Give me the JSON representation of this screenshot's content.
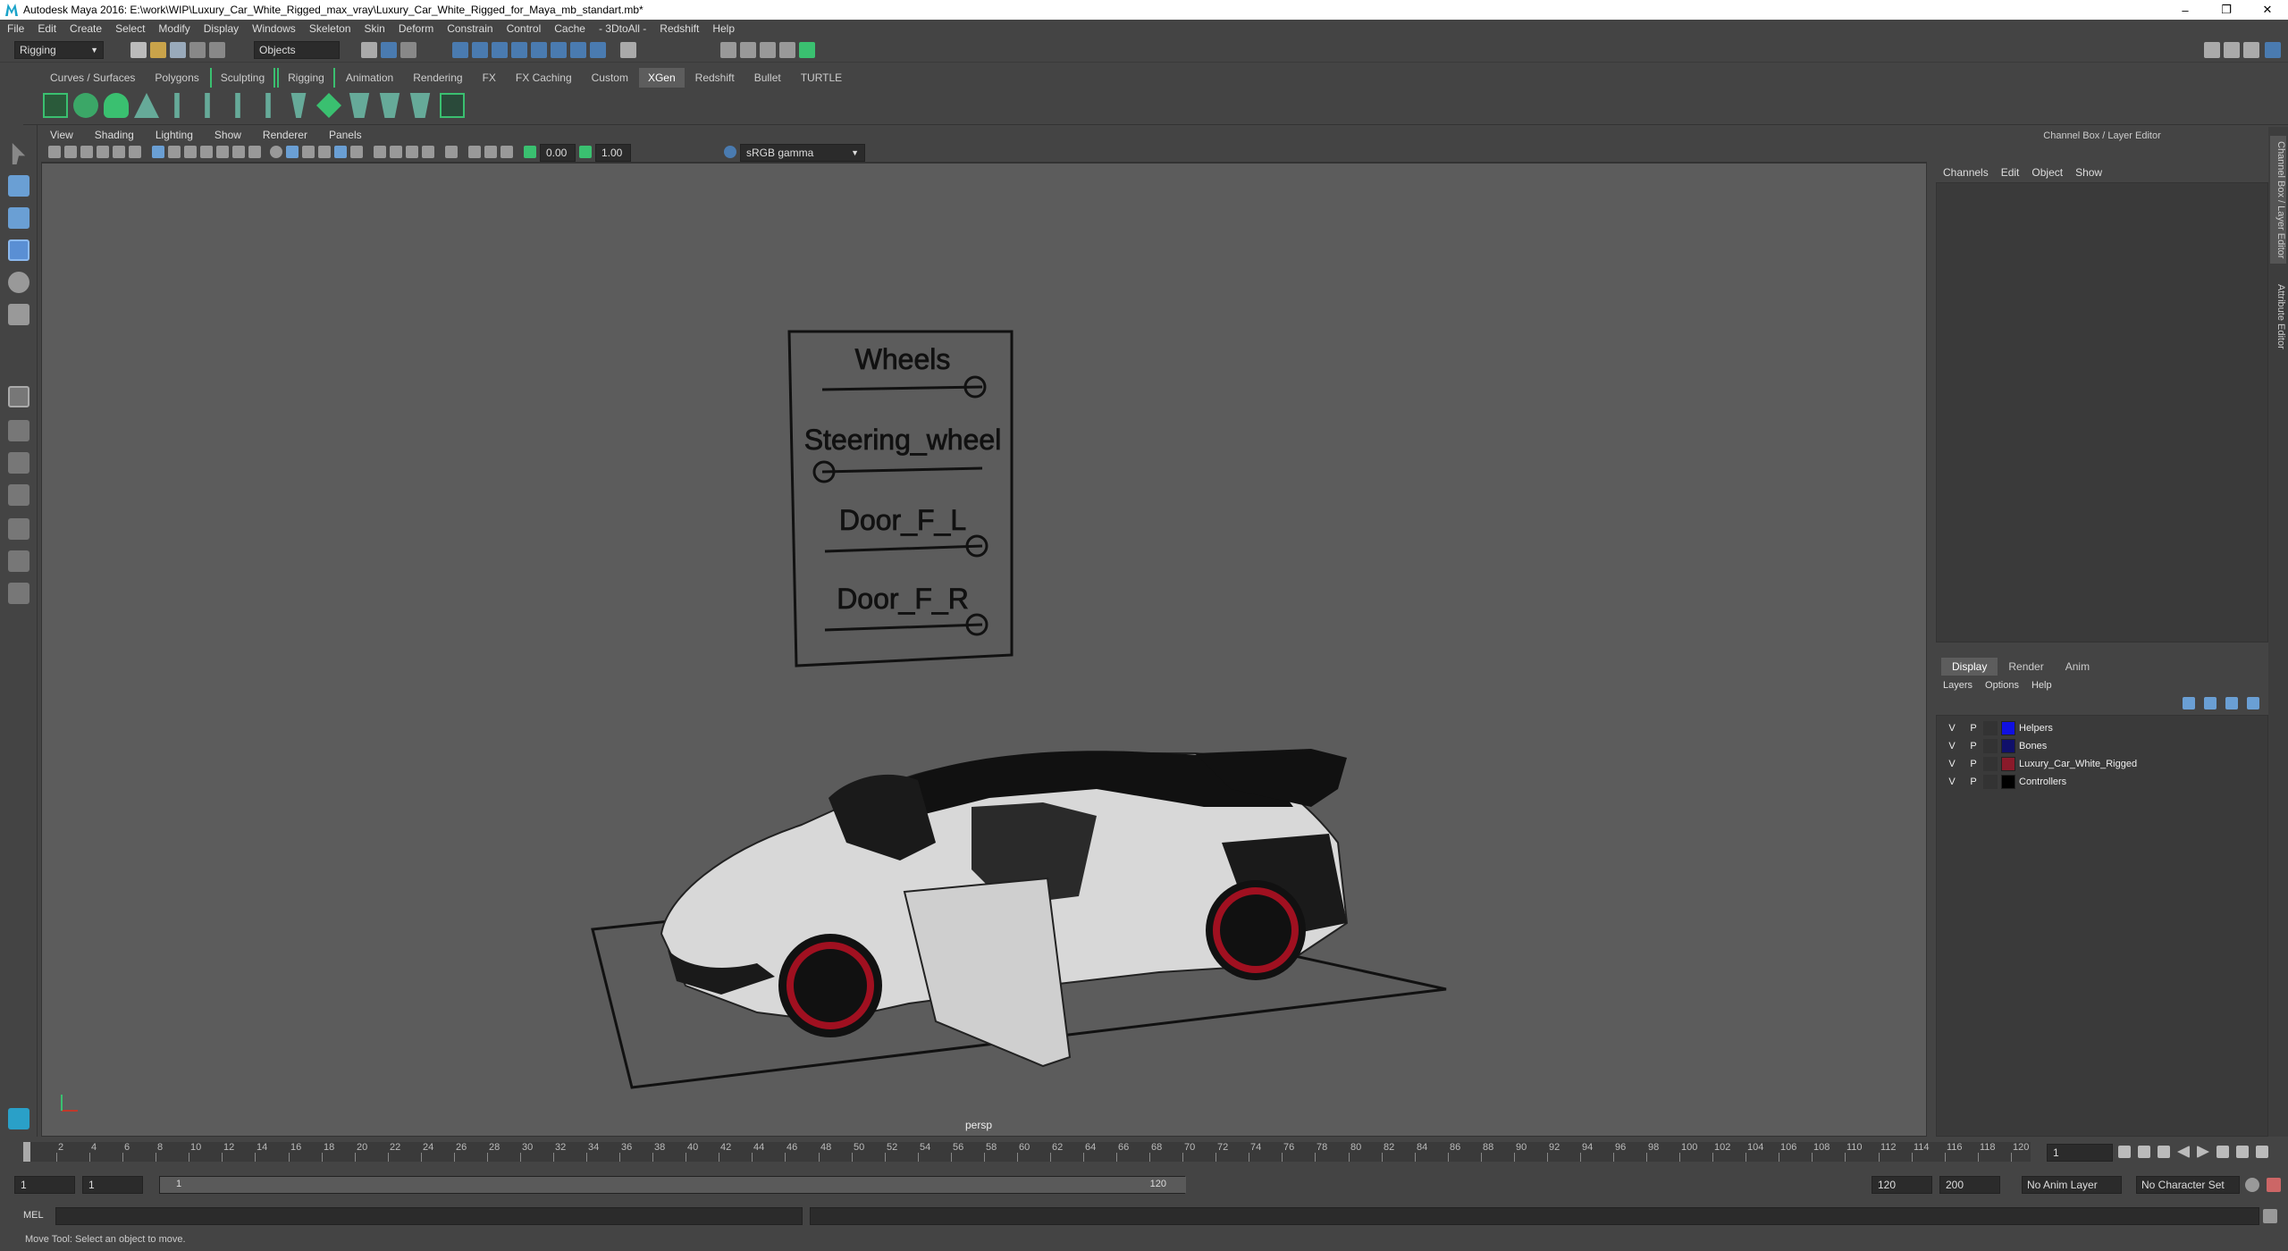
{
  "window": {
    "title": "Autodesk Maya 2016: E:\\work\\WIP\\Luxury_Car_White_Rigged_max_vray\\Luxury_Car_White_Rigged_for_Maya_mb_standart.mb*",
    "controls": [
      "–",
      "❐",
      "✕"
    ]
  },
  "menubar": [
    "File",
    "Edit",
    "Create",
    "Select",
    "Modify",
    "Display",
    "Windows",
    "Skeleton",
    "Skin",
    "Deform",
    "Constrain",
    "Control",
    "Cache",
    "- 3DtoAll -",
    "Redshift",
    "Help"
  ],
  "statusline": {
    "menuset": "Rigging",
    "selection_mode": "Objects"
  },
  "shelf_tabs": [
    "Curves / Surfaces",
    "Polygons",
    "Sculpting",
    "Rigging",
    "Animation",
    "Rendering",
    "FX",
    "FX Caching",
    "Custom",
    "XGen",
    "Redshift",
    "Bullet",
    "TURTLE"
  ],
  "active_shelf_tab": "XGen",
  "viewport": {
    "menu": [
      "View",
      "Shading",
      "Lighting",
      "Show",
      "Renderer",
      "Panels"
    ],
    "exposure": "0.00",
    "gamma": "1.00",
    "color_space": "sRGB gamma",
    "camera_label": "persp",
    "control_board": {
      "labels": [
        "Wheels",
        "Steering_wheel",
        "Door_F_L",
        "Door_F_R"
      ]
    }
  },
  "channel_box": {
    "header": "Channel Box / Layer Editor",
    "menu": [
      "Channels",
      "Edit",
      "Object",
      "Show"
    ]
  },
  "layer_editor": {
    "tabs": [
      "Display",
      "Render",
      "Anim"
    ],
    "active_tab": "Display",
    "menu": [
      "Layers",
      "Options",
      "Help"
    ],
    "layers": [
      {
        "v": "V",
        "p": "P",
        "name": "Helpers",
        "color": "#1010e0"
      },
      {
        "v": "V",
        "p": "P",
        "name": "Bones",
        "color": "#10106a"
      },
      {
        "v": "V",
        "p": "P",
        "name": "Luxury_Car_White_Rigged",
        "color": "#8a1a2a"
      },
      {
        "v": "V",
        "p": "P",
        "name": "Controllers",
        "color": "#000000"
      }
    ]
  },
  "side_tabs": [
    "Channel Box / Layer Editor",
    "Attribute Editor"
  ],
  "timeline": {
    "ticks": [
      "2",
      "4",
      "6",
      "8",
      "10",
      "12",
      "14",
      "16",
      "18",
      "20",
      "22",
      "24",
      "26",
      "28",
      "30",
      "32",
      "34",
      "36",
      "38",
      "40",
      "42",
      "44",
      "46",
      "48",
      "50",
      "52",
      "54",
      "56",
      "58",
      "60",
      "62",
      "64",
      "66",
      "68",
      "70",
      "72",
      "74",
      "76",
      "78",
      "80",
      "82",
      "84",
      "86",
      "88",
      "90",
      "92",
      "94",
      "96",
      "98",
      "100",
      "102",
      "104",
      "106",
      "108",
      "110",
      "112",
      "114",
      "116",
      "118",
      "120"
    ],
    "current_frame": "1"
  },
  "range": {
    "start": "1",
    "playback_start": "1",
    "slider_start": "1",
    "slider_end": "120",
    "playback_end": "120",
    "end": "200",
    "anim_layer": "No Anim Layer",
    "character_set": "No Character Set"
  },
  "command_line": {
    "label": "MEL"
  },
  "help_line": "Move Tool: Select an object to move."
}
